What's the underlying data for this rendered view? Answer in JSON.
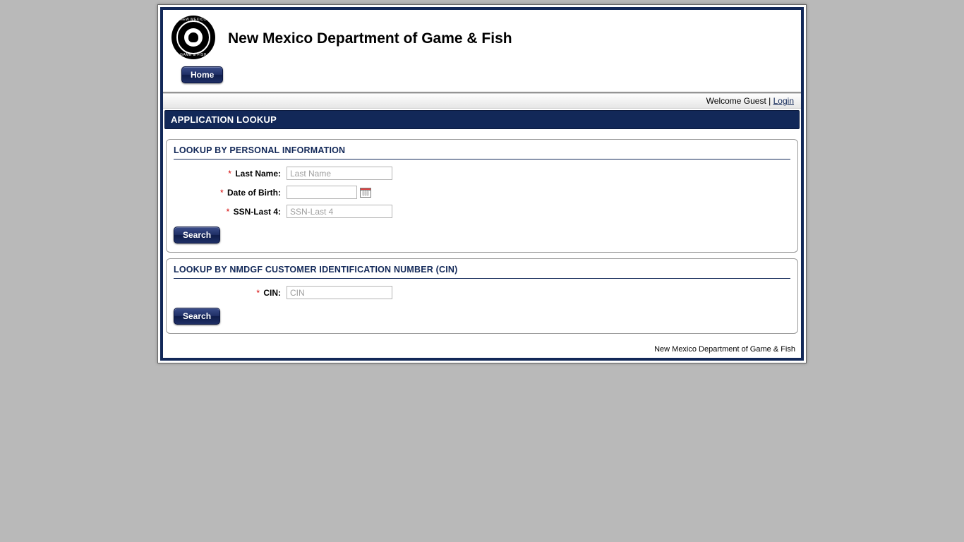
{
  "header": {
    "title": "New Mexico Department of Game & Fish",
    "seal_top": "NEW MEXICO",
    "seal_bottom": "GAME & FISH",
    "nav": {
      "home": "Home"
    }
  },
  "welcome": {
    "text": "Welcome Guest",
    "divider": " | ",
    "login": "Login"
  },
  "page": {
    "title": "APPLICATION LOOKUP"
  },
  "panelPersonal": {
    "title": "LOOKUP BY PERSONAL INFORMATION",
    "fields": {
      "lastName": {
        "label": "Last Name:",
        "placeholder": "Last Name",
        "value": ""
      },
      "dob": {
        "label": "Date of Birth:",
        "placeholder": "",
        "value": ""
      },
      "ssn": {
        "label": "SSN-Last 4:",
        "placeholder": "SSN-Last 4",
        "value": ""
      }
    },
    "search": "Search"
  },
  "panelCin": {
    "title": "LOOKUP BY NMDGF CUSTOMER IDENTIFICATION NUMBER (CIN)",
    "fields": {
      "cin": {
        "label": "CIN:",
        "placeholder": "CIN",
        "value": ""
      }
    },
    "search": "Search"
  },
  "footer": {
    "text": "New Mexico Department of Game & Fish"
  },
  "required_marker": "*"
}
